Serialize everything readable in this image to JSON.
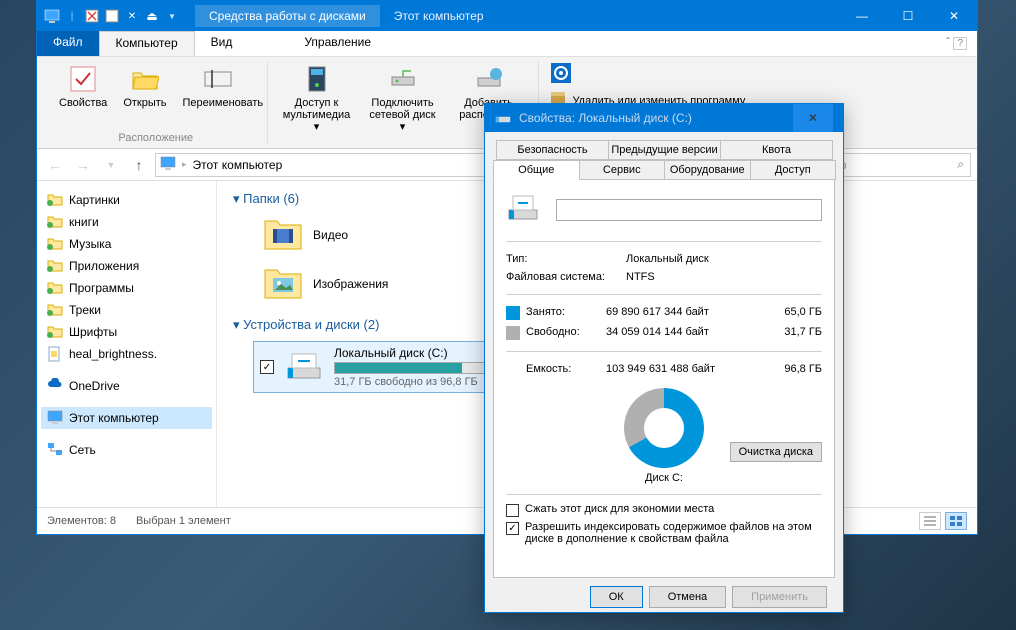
{
  "titlebar": {
    "ribbon_context_label": "Средства работы с дисками",
    "title": "Этот компьютер"
  },
  "tabs": {
    "file": "Файл",
    "computer": "Компьютер",
    "view": "Вид",
    "manage": "Управление"
  },
  "ribbon": {
    "group_location": "Расположение",
    "properties": "Свойства",
    "open": "Открыть",
    "rename": "Переименовать",
    "media_access": "Доступ к мультимедиа",
    "map_drive": "Подключить сетевой диск",
    "add_location": "Добавить располож...",
    "uninstall": "Удалить или изменить программу"
  },
  "navbar": {
    "location": "Этот компьютер",
    "search_placeholder": "мпьютер"
  },
  "sidebar": {
    "items": [
      "Картинки",
      "книги",
      "Музыка",
      "Приложения",
      "Программы",
      "Треки",
      "Шрифты",
      "heal_brightness."
    ],
    "onedrive": "OneDrive",
    "this_pc": "Этот компьютер",
    "network": "Сеть"
  },
  "main": {
    "folders_header": "Папки (6)",
    "folders": [
      "Видео",
      "Изображения"
    ],
    "drives_header": "Устройства и диски (2)",
    "drive": {
      "name": "Локальный диск (C:)",
      "subtitle": "31,7 ГБ свободно из 96,8 ГБ"
    }
  },
  "statusbar": {
    "count": "Элементов: 8",
    "selected": "Выбран 1 элемент"
  },
  "props": {
    "title": "Свойства: Локальный диск (C:)",
    "tabs_row1": [
      "Безопасность",
      "Предыдущие версии",
      "Квота"
    ],
    "tabs_row2": [
      "Общие",
      "Сервис",
      "Оборудование",
      "Доступ"
    ],
    "type_label": "Тип:",
    "type_val": "Локальный диск",
    "fs_label": "Файловая система:",
    "fs_val": "NTFS",
    "used_label": "Занято:",
    "used_bytes": "69 890 617 344 байт",
    "used_gb": "65,0 ГБ",
    "free_label": "Свободно:",
    "free_bytes": "34 059 014 144 байт",
    "free_gb": "31,7 ГБ",
    "capacity_label": "Емкость:",
    "capacity_bytes": "103 949 631 488 байт",
    "capacity_gb": "96,8 ГБ",
    "pie_label": "Диск C:",
    "cleanup": "Очистка диска",
    "compress": "Сжать этот диск для экономии места",
    "index": "Разрешить индексировать содержимое файлов на этом диске в дополнение к свойствам файла",
    "ok": "ОК",
    "cancel": "Отмена",
    "apply": "Применить"
  }
}
